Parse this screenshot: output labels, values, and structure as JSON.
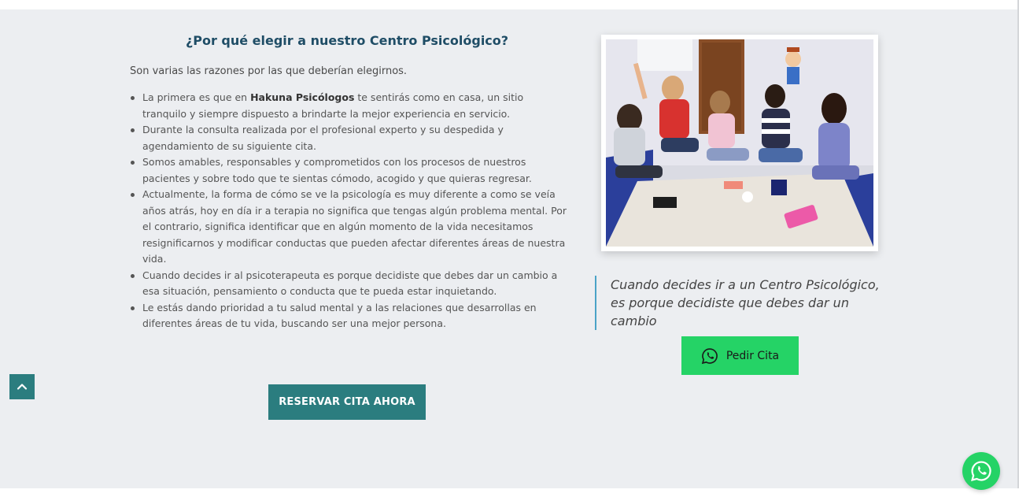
{
  "section": {
    "title": "¿Por qué elegir a nuestro Centro Psicológico?",
    "intro": "Son varias las razones por las que deberían elegirnos.",
    "reasons": [
      {
        "before": "La primera es que en ",
        "bold": "Hakuna Psicólogos",
        "after": " te sentirás como en casa, un sitio tranquilo y siempre dispuesto a brindarte la mejor experiencia en servicio."
      },
      {
        "text": "Durante la consulta realizada por el profesional experto y su despedida y agendamiento de su siguiente cita."
      },
      {
        "text": "Somos amables, responsables y comprometidos con los procesos de nuestros pacientes y sobre todo que te sientas cómodo, acogido y que quieras regresar."
      },
      {
        "text": "Actualmente, la forma de cómo se ve la psicología es muy diferente a como se veía años atrás, hoy en día ir a terapia no significa que tengas algún problema mental. Por el contrario, significa identificar que en algún momento de la vida necesitamos resignificarnos y modificar conductas que pueden afectar diferentes áreas de nuestra vida."
      },
      {
        "text": "Cuando decides ir al psicoterapeuta es porque decidiste que debes dar un cambio a esa situación, pensamiento o conducta que te pueda estar inquietando."
      },
      {
        "text": "Le estás dando prioridad a tu salud mental y a las relaciones que desarrollas en diferentes áreas de tu vida, buscando ser una mejor persona."
      }
    ],
    "reserve_label": "RESERVAR CITA AHORA",
    "quote": "Cuando decides ir a un Centro Psicológico, es porque decidiste que debes dar un cambio",
    "cita_label": "Pedir Cita"
  },
  "icons": {
    "scroll_top": "chevron-up-icon",
    "whatsapp": "whatsapp-icon"
  },
  "colors": {
    "accent": "#2b7d7f",
    "whatsapp": "#25d366",
    "title": "#1f4d66",
    "quote_border": "#4aa3c7"
  }
}
